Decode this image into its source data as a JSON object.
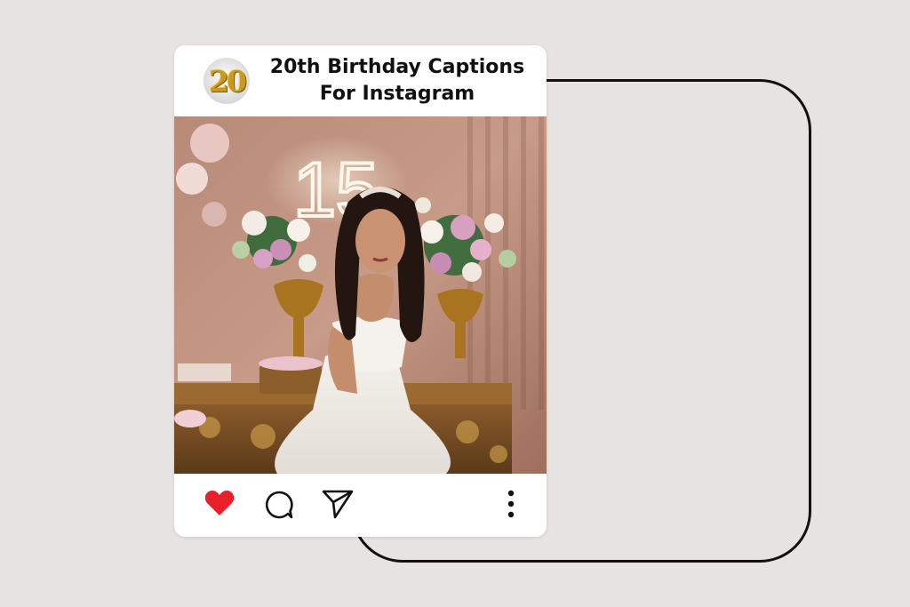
{
  "post": {
    "avatar_text": "20",
    "title_line1": "20th Birthday Captions",
    "title_line2": "For Instagram",
    "photo": {
      "neon_sign": "15",
      "alt": "Girl in white ball gown in front of floral birthday decorations"
    },
    "actions": {
      "like_icon": "heart-icon",
      "like_color": "#e8202a",
      "comment_icon": "comment-bubble-icon",
      "share_icon": "paper-plane-icon",
      "more_icon": "vertical-dots-icon"
    }
  },
  "colors": {
    "page_background": "#e8e3e3",
    "card_background": "#ffffff",
    "outline": "#111111"
  }
}
